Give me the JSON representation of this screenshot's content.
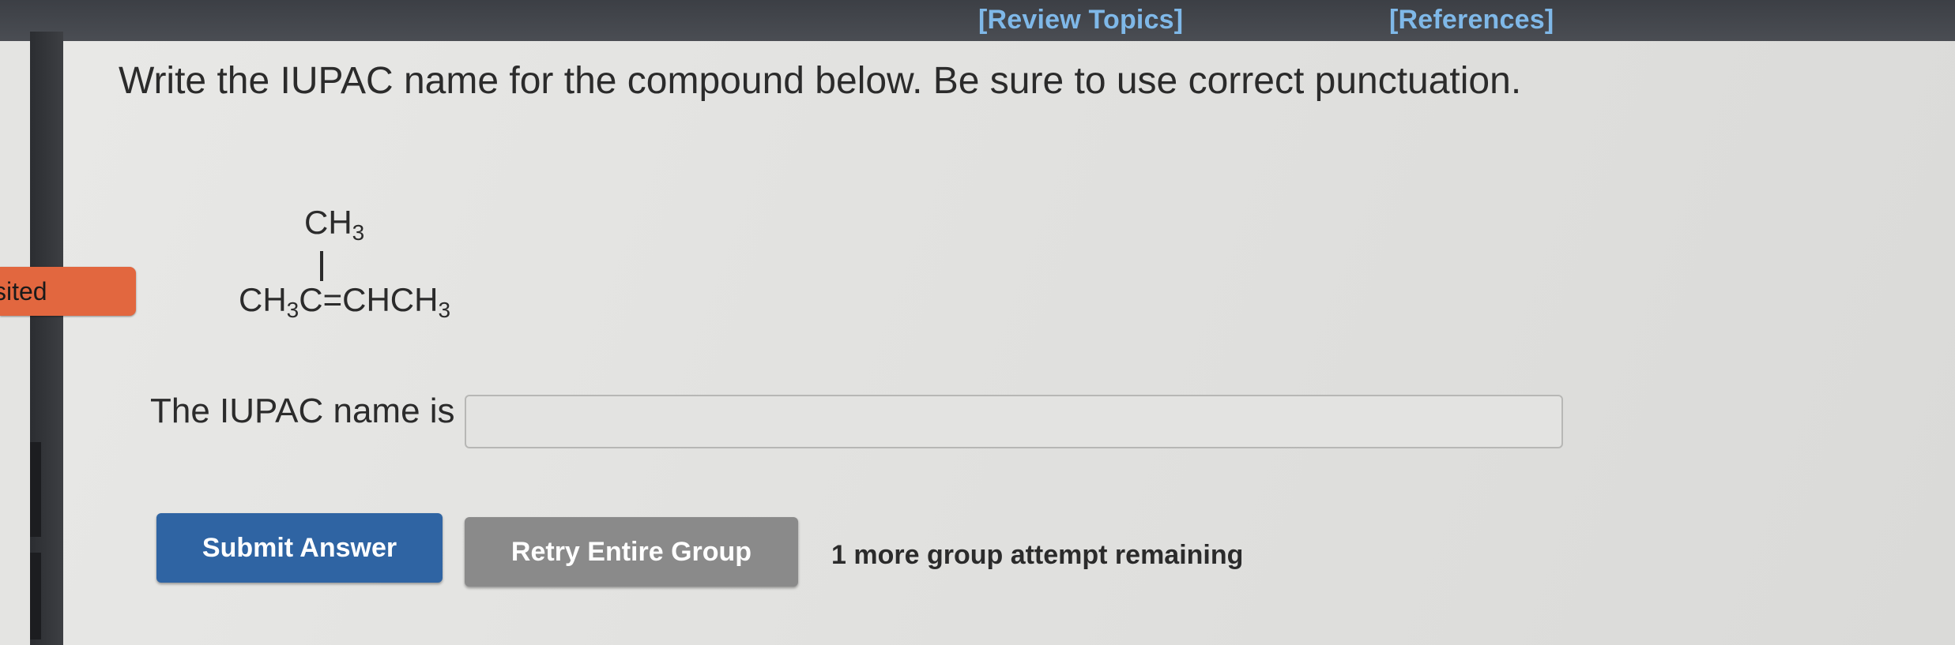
{
  "header": {
    "review_topics": "[Review Topics]",
    "references": "[References]"
  },
  "sidebar": {
    "visited_tab": "sited"
  },
  "question": {
    "prompt": "Write the IUPAC name for the compound below. Be sure to use correct punctuation."
  },
  "structure": {
    "top_group_main": "CH",
    "top_group_sub": "3",
    "row_part1_main": "CH",
    "row_part1_sub": "3",
    "row_part2_main": "C=CHCH",
    "row_part2_sub": "3"
  },
  "answer": {
    "label": "The IUPAC name is",
    "value": "",
    "placeholder": ""
  },
  "buttons": {
    "submit": "Submit Answer",
    "retry": "Retry Entire Group"
  },
  "status": {
    "attempts": "1 more group attempt remaining"
  },
  "colors": {
    "topbar": "#3c3f45",
    "link": "#7fb8e8",
    "submit_button": "#2f64a3",
    "retry_button": "#8a8a8a",
    "visited_tab": "#e2673f"
  }
}
